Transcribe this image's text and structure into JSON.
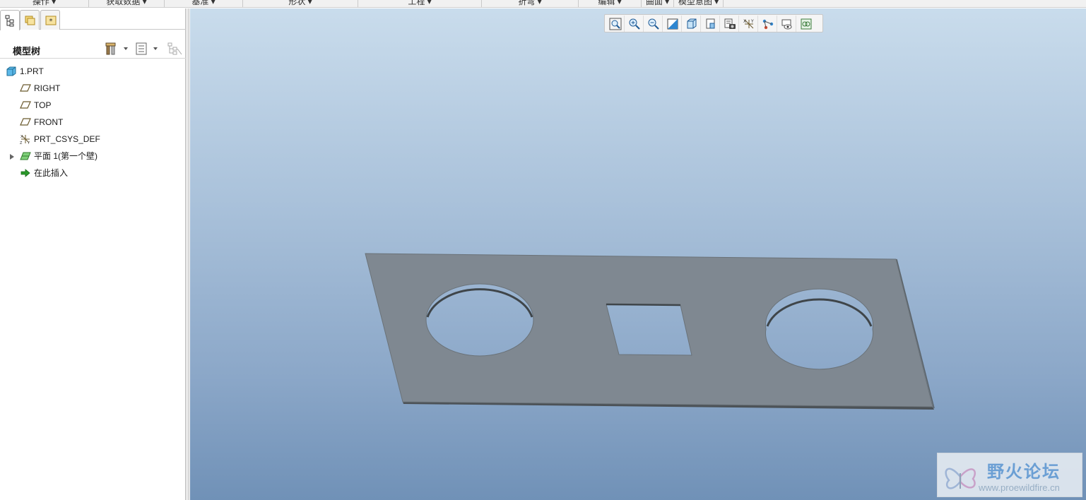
{
  "ribbon": {
    "groups": [
      "操作",
      "获取数据",
      "基准",
      "形状",
      "工程",
      "折弯",
      "编辑",
      "曲面",
      "模型意图"
    ]
  },
  "left_panel": {
    "tabs": [
      "model-tree-tab",
      "folder-browser-tab",
      "favorites-tab"
    ],
    "header_title": "模型树",
    "tree": [
      {
        "label": "1.PRT",
        "icon": "part-icon"
      },
      {
        "label": "RIGHT",
        "icon": "datum-plane-icon"
      },
      {
        "label": "TOP",
        "icon": "datum-plane-icon"
      },
      {
        "label": "FRONT",
        "icon": "datum-plane-icon"
      },
      {
        "label": "PRT_CSYS_DEF",
        "icon": "csys-icon"
      },
      {
        "label": "平面 1(第一个壁)",
        "icon": "sheetmetal-wall-icon"
      },
      {
        "label": "在此插入",
        "icon": "insert-arrow-icon"
      }
    ]
  },
  "view_toolbar": {
    "buttons": [
      "refit-icon",
      "zoom-in-icon",
      "zoom-out-icon",
      "repaint-icon",
      "display-style-icon",
      "saved-orientations-icon",
      "view-manager-icon",
      "datum-display-icon",
      "annotation-display-icon",
      "spin-center-icon",
      "appearance-icon"
    ]
  },
  "watermark": {
    "title": "野火论坛",
    "url": "www.proewildfire.cn"
  },
  "colors": {
    "part_fill": "#7f8891",
    "part_edge": "#5b6268",
    "viewport_top": "#c9dcec",
    "viewport_bottom": "#7091b7"
  }
}
